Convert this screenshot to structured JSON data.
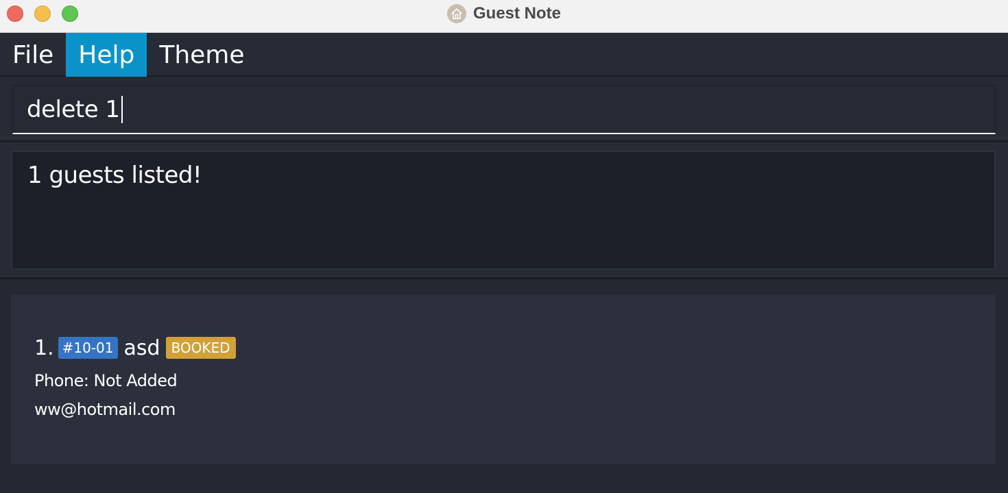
{
  "window": {
    "title": "Guest Note",
    "app_icon": "house-icon"
  },
  "menu": {
    "items": [
      {
        "label": "File",
        "active": false
      },
      {
        "label": "Help",
        "active": true
      },
      {
        "label": "Theme",
        "active": false
      }
    ]
  },
  "command": {
    "value": "delete 1"
  },
  "result": {
    "message": "1 guests listed!"
  },
  "guests": [
    {
      "index": "1.",
      "room": "#10-01",
      "name": "asd",
      "status": "BOOKED",
      "phone": "Phone: Not Added",
      "email": "ww@hotmail.com"
    }
  ],
  "colors": {
    "accent": "#0b93c9",
    "room_tag": "#3574c4",
    "status_tag": "#d1a138",
    "background": "#242832"
  }
}
